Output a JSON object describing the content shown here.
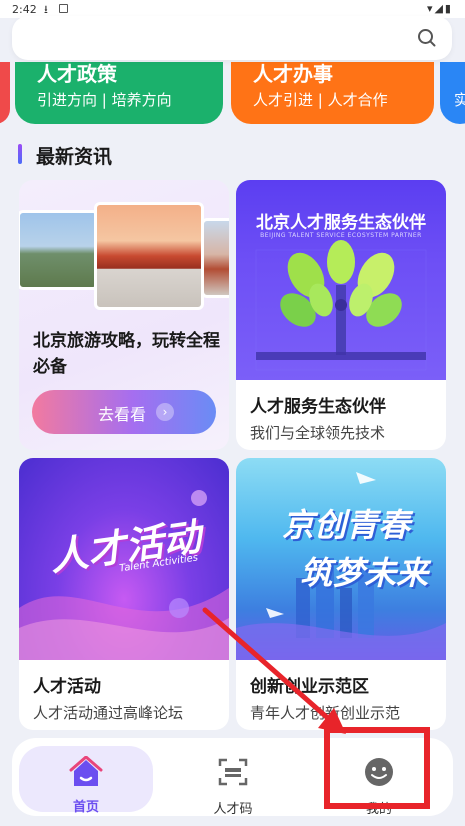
{
  "status_bar": {
    "time": "2:42",
    "download_glyph": "⭳",
    "right_icons": "▾◢▮"
  },
  "search": {
    "icon": "search-icon"
  },
  "quick_cards": [
    {
      "title": "人才政策",
      "sub": "引进方向 | 培养方向",
      "color": "#1bb16c"
    },
    {
      "title": "人才办事",
      "sub": "人才引进 | 人才合作",
      "color": "#ff7316"
    },
    {
      "title": "",
      "sub": "实",
      "color": "#2a86f5"
    }
  ],
  "section": {
    "title": "最新资讯"
  },
  "cards": {
    "travel": {
      "title": "北京旅游攻略，玩转全程必备",
      "button": "去看看",
      "arrow": "›"
    },
    "eco": {
      "image_title": "北京人才服务生态伙伴",
      "image_sub": "BEIJING TALENT SERVICE ECOSYSTEM PARTNER",
      "title": "人才服务生态伙伴",
      "desc": "我们与全球领先技术"
    },
    "activity": {
      "image_title": "人才活动",
      "image_sub": "Talent Activities",
      "title": "人才活动",
      "desc": "人才活动通过高峰论坛"
    },
    "innovation": {
      "image_line1": "京创青春",
      "image_line2": "筑梦未来",
      "title": "创新创业示范区",
      "desc": "青年人才创新创业示范"
    }
  },
  "tabbar": {
    "tabs": [
      {
        "label": "首页",
        "icon": "home-icon",
        "active": true
      },
      {
        "label": "人才码",
        "icon": "scan-code-icon",
        "active": false
      },
      {
        "label": "我的",
        "icon": "profile-icon",
        "active": false
      }
    ]
  },
  "annotation": {
    "color": "#e8242a"
  }
}
